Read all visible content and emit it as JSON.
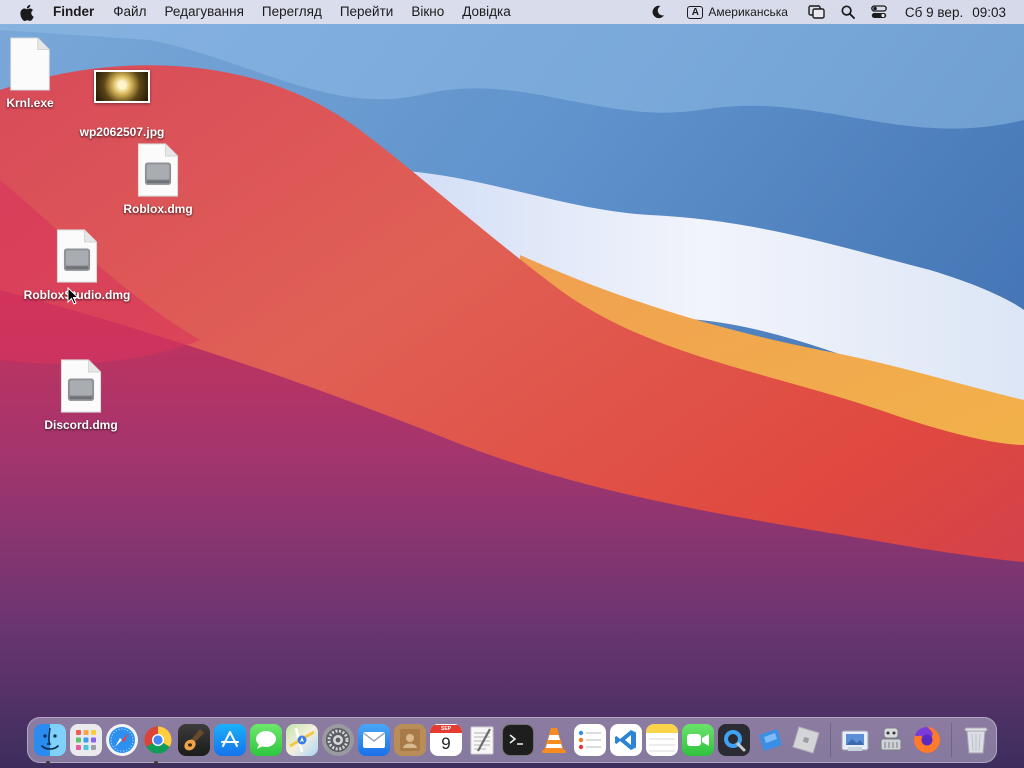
{
  "menubar": {
    "app_name": "Finder",
    "menus": [
      "Файл",
      "Редагування",
      "Перегляд",
      "Перейти",
      "Вікно",
      "Довідка"
    ],
    "input_source_letter": "A",
    "input_source_label": "Американська",
    "date": "Сб 9 вер.",
    "time": "09:03"
  },
  "desktop": {
    "icons": [
      {
        "name": "Krnl.exe",
        "kind": "generic-file-icon"
      },
      {
        "name": "wp2062507.jpg",
        "kind": "image-thumbnail"
      },
      {
        "name": "Roblox.dmg",
        "kind": "disk-image-icon"
      },
      {
        "name": "RobloxStudio.dmg",
        "kind": "disk-image-icon"
      },
      {
        "name": "Discord.dmg",
        "kind": "disk-image-icon"
      }
    ]
  },
  "dock": {
    "apps": [
      {
        "id": "finder",
        "running": true
      },
      {
        "id": "launchpad",
        "running": false
      },
      {
        "id": "safari",
        "running": false
      },
      {
        "id": "chrome",
        "running": true
      },
      {
        "id": "garageband",
        "running": false
      },
      {
        "id": "app-store",
        "running": false
      },
      {
        "id": "messages",
        "running": false
      },
      {
        "id": "maps",
        "running": false
      },
      {
        "id": "system-preferences",
        "running": false
      },
      {
        "id": "mail",
        "running": false
      },
      {
        "id": "contacts",
        "running": false
      },
      {
        "id": "calendar",
        "running": false
      },
      {
        "id": "textedit",
        "running": false
      },
      {
        "id": "terminal",
        "running": false
      },
      {
        "id": "vlc",
        "running": false
      },
      {
        "id": "reminders",
        "running": false
      },
      {
        "id": "vscode",
        "running": false
      },
      {
        "id": "notes",
        "running": false
      },
      {
        "id": "facetime",
        "running": false
      },
      {
        "id": "quicktime",
        "running": false
      },
      {
        "id": "roblox-studio",
        "running": false
      },
      {
        "id": "roblox",
        "running": false
      }
    ],
    "calendar_month": "SEP",
    "calendar_day": "9",
    "recent": [
      "preview",
      "automator",
      "firefox"
    ],
    "trash": "trash"
  },
  "colors": {
    "menubar_bg": "#ece8f0",
    "label_text": "#ffffff"
  }
}
